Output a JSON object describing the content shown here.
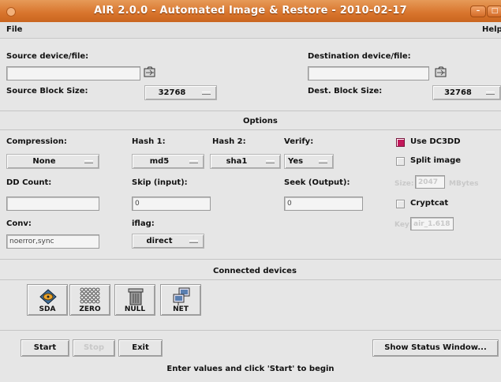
{
  "window": {
    "title": "AIR 2.0.0 - Automated Image & Restore - 2010-02-17"
  },
  "menu": {
    "file": "File",
    "help": "Help"
  },
  "source": {
    "label": "Source device/file:",
    "value": "",
    "block_size_label": "Source Block Size:",
    "block_size": "32768"
  },
  "destination": {
    "label": "Destination device/file:",
    "value": "",
    "block_size_label": "Dest. Block Size:",
    "block_size": "32768"
  },
  "options": {
    "title": "Options",
    "compression_label": "Compression:",
    "compression": "None",
    "hash1_label": "Hash 1:",
    "hash1": "md5",
    "hash2_label": "Hash 2:",
    "hash2": "sha1",
    "verify_label": "Verify:",
    "verify": "Yes",
    "use_dc3dd_label": "Use DC3DD",
    "use_dc3dd": true,
    "split_image_label": "Split image",
    "split_image": false,
    "dd_count_label": "DD Count:",
    "dd_count": "",
    "skip_label": "Skip (input):",
    "skip": "0",
    "seek_label": "Seek (Output):",
    "seek": "0",
    "size_label": "Size:",
    "size": "2047",
    "size_unit": "MBytes",
    "cryptcat_label": "Cryptcat",
    "cryptcat": false,
    "conv_label": "Conv:",
    "conv": "noerror,sync",
    "iflag_label": "iflag:",
    "iflag": "direct",
    "key_label": "Key:",
    "key": "air_1.618"
  },
  "devices": {
    "title": "Connected devices",
    "items": [
      {
        "label": "SDA",
        "icon": "hard-disk-icon"
      },
      {
        "label": "ZERO",
        "icon": "zero-grid-icon"
      },
      {
        "label": "NULL",
        "icon": "trash-can-icon"
      },
      {
        "label": "NET",
        "icon": "network-icon"
      }
    ]
  },
  "buttons": {
    "start": "Start",
    "stop": "Stop",
    "exit": "Exit",
    "status": "Show Status Window..."
  },
  "status": "Enter values and click 'Start' to begin",
  "colors": {
    "titlebar": "#d8742c",
    "checkbox_on": "#c2185b"
  }
}
